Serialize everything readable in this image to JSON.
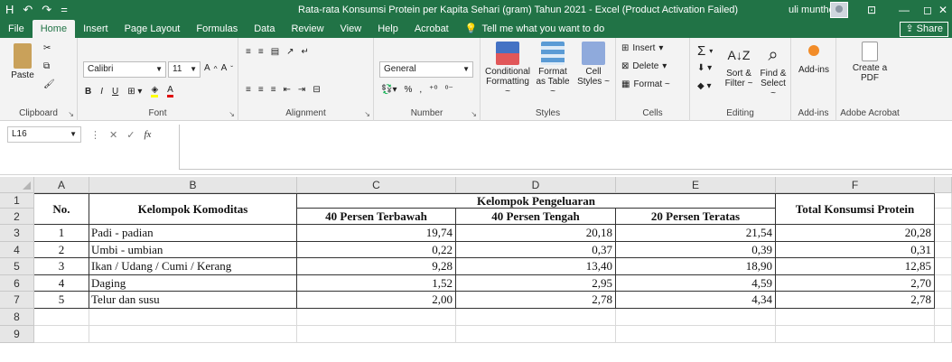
{
  "titlebar": {
    "title": "Rata-rata Konsumsi Protein per Kapita Sehari (gram) Tahun 2021  -  Excel (Product Activation Failed)",
    "user": "uli munthe",
    "qat": [
      "H",
      "↶",
      "↷",
      "="
    ],
    "controls": [
      "⊡",
      "—",
      "◻",
      "✕"
    ]
  },
  "tabs": [
    "File",
    "Home",
    "Insert",
    "Page Layout",
    "Formulas",
    "Data",
    "Review",
    "View",
    "Help",
    "Acrobat"
  ],
  "active_tab": "Home",
  "tell_me": "Tell me what you want to do",
  "share": "Share",
  "ribbon": {
    "clipboard": {
      "label": "Clipboard",
      "paste": "Paste"
    },
    "font": {
      "label": "Font",
      "name": "Calibri",
      "size": "11",
      "bold": "B",
      "italic": "I",
      "underline": "U"
    },
    "alignment": {
      "label": "Alignment"
    },
    "number": {
      "label": "Number",
      "format": "General",
      "percent": "%",
      "comma": ","
    },
    "styles": {
      "label": "Styles",
      "conditional": "Conditional Formatting ~",
      "format_as": "Format as Table ~",
      "cell_styles": "Cell Styles ~"
    },
    "cells": {
      "label": "Cells",
      "insert": "Insert",
      "delete": "Delete",
      "format": "Format ~"
    },
    "editing": {
      "label": "Editing",
      "sort": "Sort & Filter ~",
      "find": "Find & Select ~",
      "sum": "Σ"
    },
    "addins": {
      "label": "Add-ins",
      "btn": "Add-ins"
    },
    "acrobat": {
      "label": "Adobe Acrobat",
      "btn": "Create a PDF"
    }
  },
  "formula_bar": {
    "name_box": "L16",
    "fx": "fx",
    "cancel": "✕",
    "enter": "✓",
    "content": ""
  },
  "columns": [
    "A",
    "B",
    "C",
    "D",
    "E",
    "F"
  ],
  "rows": [
    "1",
    "2",
    "3",
    "4",
    "5",
    "6",
    "7",
    "8",
    "9"
  ],
  "table": {
    "no_header": "No.",
    "commodity_header": "Kelompok Komoditas",
    "expenditure_header": "Kelompok Pengeluaran",
    "sub_headers": [
      "40 Persen Terbawah",
      "40 Persen Tengah",
      "20 Persen Teratas"
    ],
    "total_header": "Total Konsumsi Protein",
    "rows": [
      {
        "no": "1",
        "name": "Padi - padian",
        "c": "19,74",
        "d": "20,18",
        "e": "21,54",
        "f": "20,28"
      },
      {
        "no": "2",
        "name": "Umbi - umbian",
        "c": "0,22",
        "d": "0,37",
        "e": "0,39",
        "f": "0,31"
      },
      {
        "no": "3",
        "name": "Ikan / Udang / Cumi / Kerang",
        "c": "9,28",
        "d": "13,40",
        "e": "18,90",
        "f": "12,85"
      },
      {
        "no": "4",
        "name": "Daging",
        "c": "1,52",
        "d": "2,95",
        "e": "4,59",
        "f": "2,70"
      },
      {
        "no": "5",
        "name": "Telur dan susu",
        "c": "2,00",
        "d": "2,78",
        "e": "4,34",
        "f": "2,78"
      }
    ]
  },
  "colors": {
    "excel_green": "#217346",
    "ribbon_bg": "#f3f3f3",
    "header_bg": "#e6e6e6"
  }
}
